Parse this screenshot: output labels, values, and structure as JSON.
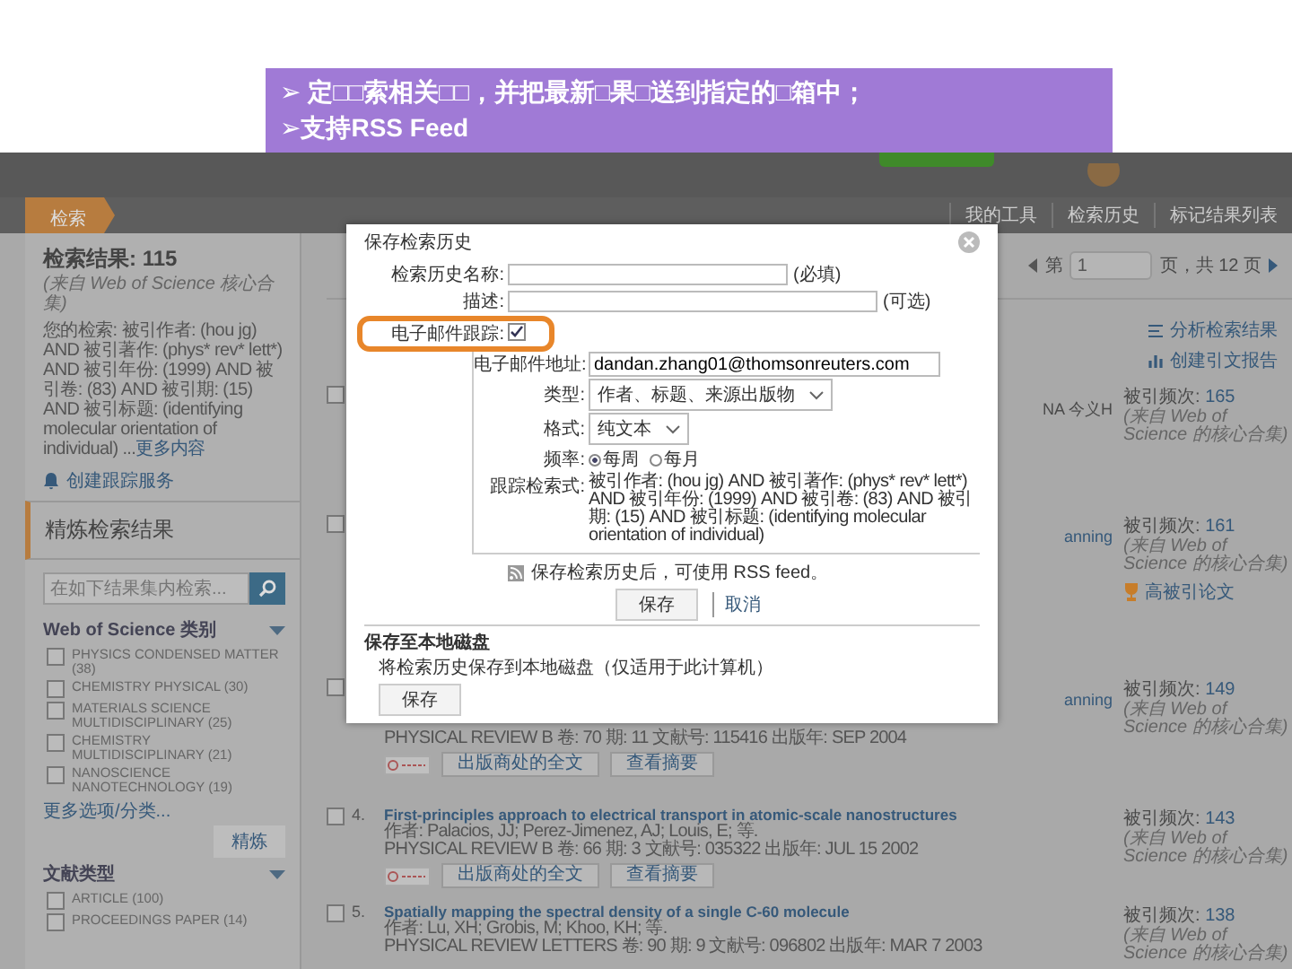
{
  "banner": {
    "lines": [
      "➢ 定□□索相关□□，并把最新□果□送到指定的□箱中；",
      "➢支持RSS Feed"
    ]
  },
  "nav": {
    "tabs": [
      {
        "label": "检索",
        "selected": true
      }
    ],
    "links": [
      "我的工具",
      "检索历史",
      "标记结果列表"
    ]
  },
  "sidebar": {
    "result_title": "检索结果: 115",
    "result_note": "(来自 Web of Science 核心合集)",
    "query": "您的检索: 被引作者: (hou jg) AND 被引著作: (phys* rev* lett*) AND 被引年份: (1999) AND 被引卷: (83) AND 被引期: (15) AND 被引标题: (identifying molecular orientation of individual) ...",
    "query_more": "更多内容",
    "alert_link": "创建跟踪服务",
    "refine_title": "精炼检索结果",
    "search": {
      "placeholder": "在如下结果集内检索..."
    },
    "category_title": "Web of Science 类别",
    "categories": [
      {
        "label": "PHYSICS CONDENSED MATTER (38)",
        "checked": false
      },
      {
        "label": "CHEMISTRY PHYSICAL (30)",
        "checked": false
      },
      {
        "label": "MATERIALS SCIENCE MULTIDISCIPLINARY (25)",
        "checked": false
      },
      {
        "label": "CHEMISTRY MULTIDISCIPLINARY (21)",
        "checked": false
      },
      {
        "label": "NANOSCIENCE NANOTECHNOLOGY (19)",
        "checked": false
      }
    ],
    "more_options": "更多选项/分类...",
    "refine_button": "精炼",
    "doctype_title": "文献类型",
    "doctypes": [
      {
        "label": "ARTICLE (100)",
        "checked": false
      },
      {
        "label": "PROCEEDINGS PAPER (14)",
        "checked": false
      }
    ]
  },
  "pagination": {
    "prefix": "第",
    "page": "1",
    "suffix": "页，共 12 页"
  },
  "tools": [
    "分析检索结果",
    "创建引文报告"
  ],
  "results": [
    {
      "checked": false,
      "fragment": "NA 今义H",
      "citations_label": "被引频次:",
      "citations": "165",
      "citation_note": "(来自 Web of Science 的核心合集)"
    },
    {
      "checked": false,
      "fragment": "anning",
      "citations_label": "被引频次:",
      "citations": "161",
      "citation_note": "(来自 Web of Science 的核心合集)",
      "award": "高被引论文"
    },
    {
      "checked": false,
      "fragment": "anning",
      "source": "PHYSICAL REVIEW B 卷: 70 期: 11 文献号: 115416 出版年: SEP 2004",
      "buttons": [
        "出版商处的全文",
        "查看摘要"
      ],
      "citations_label": "被引频次:",
      "citations": "149",
      "citation_note": "(来自 Web of Science 的核心合集)"
    },
    {
      "checked": false,
      "number": "4.",
      "title": "First-principles approach to electrical transport in atomic-scale nanostructures",
      "authors": "作者: Palacios, JJ; Perez-Jimenez, AJ; Louis, E; 等.",
      "source": "PHYSICAL REVIEW B 卷: 66 期: 3 文献号: 035322 出版年: JUL 15 2002",
      "buttons": [
        "出版商处的全文",
        "查看摘要"
      ],
      "citations_label": "被引频次:",
      "citations": "143",
      "citation_note": "(来自 Web of Science 的核心合集)"
    },
    {
      "checked": false,
      "number": "5.",
      "title": "Spatially mapping the spectral density of a single C-60 molecule",
      "authors": "作者: Lu, XH; Grobis, M; Khoo, KH; 等.",
      "source": "PHYSICAL REVIEW LETTERS 卷: 90 期: 9 文献号: 096802 出版年: MAR 7 2003",
      "citations_label": "被引频次:",
      "citations": "138",
      "citation_note": "(来自 Web of Science 的核心合集)"
    }
  ],
  "dialog": {
    "title": "保存检索历史",
    "fields": [
      {
        "label": "检索历史名称:",
        "hint": "(必填)"
      },
      {
        "label": "描述:",
        "hint": "(可选)"
      }
    ],
    "email_alert": {
      "label": "电子邮件跟踪:",
      "checked": true,
      "highlighted": true
    },
    "email": {
      "label": "电子邮件地址:",
      "value": "dandan.zhang01@thomsonreuters.com"
    },
    "type": {
      "label": "类型:",
      "value": "作者、标题、来源出版物"
    },
    "format": {
      "label": "格式:",
      "value": "纯文本"
    },
    "frequency": {
      "label": "频率:",
      "options": [
        {
          "label": "每周",
          "selected": true
        },
        {
          "label": "每月",
          "selected": false
        }
      ]
    },
    "query": {
      "label": "跟踪检索式:",
      "text": "被引作者: (hou jg) AND 被引著作: (phys* rev* lett*) AND 被引年份: (1999) AND 被引卷: (83) AND 被引期: (15) AND 被引标题: (identifying molecular orientation of individual)"
    },
    "rss_note": "保存检索历史后，可使用 RSS feed。",
    "save_button": "保存",
    "cancel_link": "取消",
    "local_title": "保存至本地磁盘",
    "local_note": "将检索历史保存到本地磁盘（仅适用于此计算机）",
    "local_button": "保存"
  }
}
